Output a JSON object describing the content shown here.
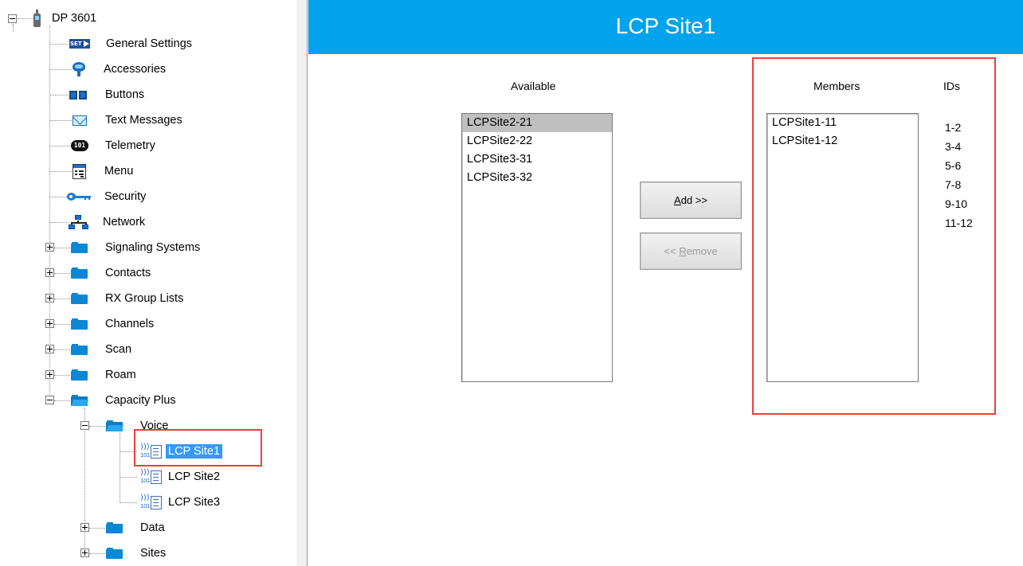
{
  "tree": {
    "root": {
      "label": "DP 3601",
      "icon": "radio-device-icon"
    },
    "items": [
      {
        "label": "General Settings",
        "icon": "settings-badge-icon"
      },
      {
        "label": "Accessories",
        "icon": "accessory-icon"
      },
      {
        "label": "Buttons",
        "icon": "buttons-icon"
      },
      {
        "label": "Text Messages",
        "icon": "envelope-icon"
      },
      {
        "label": "Telemetry",
        "icon": "telemetry-icon"
      },
      {
        "label": "Menu",
        "icon": "menu-icon"
      },
      {
        "label": "Security",
        "icon": "key-icon"
      },
      {
        "label": "Network",
        "icon": "network-icon"
      },
      {
        "label": "Signaling Systems",
        "icon": "folder-icon"
      },
      {
        "label": "Contacts",
        "icon": "folder-icon"
      },
      {
        "label": "RX Group Lists",
        "icon": "folder-icon"
      },
      {
        "label": "Channels",
        "icon": "folder-icon"
      },
      {
        "label": "Scan",
        "icon": "folder-icon"
      },
      {
        "label": "Roam",
        "icon": "folder-icon"
      },
      {
        "label": "Capacity Plus",
        "icon": "folder-open-icon"
      },
      {
        "label": "Voice",
        "icon": "folder-open-icon"
      },
      {
        "label": "LCP Site1",
        "icon": "site-document-icon",
        "selected": true
      },
      {
        "label": "LCP Site2",
        "icon": "site-document-icon"
      },
      {
        "label": "LCP Site3",
        "icon": "site-document-icon"
      },
      {
        "label": "Data",
        "icon": "folder-icon"
      },
      {
        "label": "Sites",
        "icon": "folder-icon"
      }
    ],
    "tele_glyph": "101"
  },
  "panel": {
    "title": "LCP Site1",
    "available_header": "Available",
    "members_header": "Members",
    "ids_header": "IDs",
    "available": [
      "LCPSite2-21",
      "LCPSite2-22",
      "LCPSite3-31",
      "LCPSite3-32"
    ],
    "members": [
      "LCPSite1-11",
      "LCPSite1-12"
    ],
    "ids": [
      "1-2",
      "3-4",
      "5-6",
      "7-8",
      "9-10",
      "11-12"
    ],
    "add_button": {
      "accel": "A",
      "rest": "dd >>"
    },
    "remove_button": {
      "before": "<< ",
      "accel": "R",
      "rest": "emove",
      "enabled": false
    },
    "set_badge_text": "SET"
  },
  "colors": {
    "title_bar": "#00a3ec",
    "selection": "#3399ff",
    "highlight_frame": "#e8413a",
    "folder": "#0a88d6"
  }
}
